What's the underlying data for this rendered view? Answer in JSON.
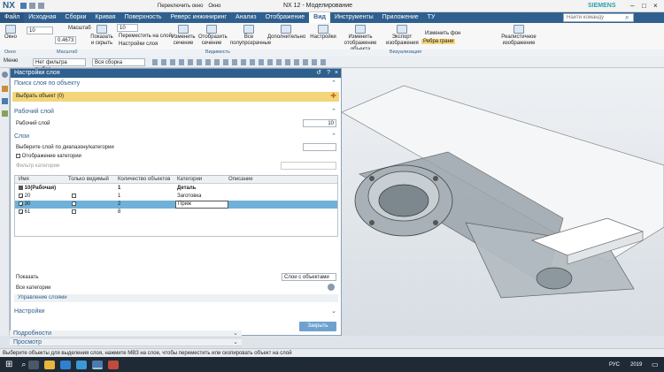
{
  "window": {
    "title": "NX 12 - Моделирование",
    "brand": "SIEMENS",
    "app_short": "NX",
    "switch_window": "Переключить окно",
    "window_menu": "Окно"
  },
  "search": {
    "placeholder": "Найти команду"
  },
  "menu": {
    "items": [
      "Файл",
      "Исходная",
      "Сборки",
      "Кривая",
      "Поверхность",
      "Реверс инжиниринг",
      "Анализ",
      "Отображение",
      "Вид",
      "Инструменты",
      "Приложение",
      "ТУ"
    ],
    "active_index": 8
  },
  "ribbon": {
    "buttons": [
      {
        "label": "Окно"
      },
      {
        "label": "Масштаб"
      },
      {
        "label": "Показать и скрыть"
      },
      {
        "label": "Переместить на слой"
      },
      {
        "label": "Настройки слоя"
      },
      {
        "label": "Изменить сечение"
      },
      {
        "label": "Отобразить сечение"
      },
      {
        "label": "Все полупрозрачные"
      },
      {
        "label": "Дополнительно"
      },
      {
        "label": "Настройки"
      },
      {
        "label": "Изменить отображение объекта"
      },
      {
        "label": "Экспорт изображения"
      },
      {
        "label": "Изменить фон"
      },
      {
        "label": "Ребра грани"
      },
      {
        "label": "Реалистичное изображение"
      }
    ],
    "layer_value": "10",
    "scale_value": "0.4673",
    "groups": [
      "Окно",
      "Масштаб",
      "Видимость",
      "Визуализация"
    ]
  },
  "toolbar2": {
    "menu": "Меню",
    "filter": "Нет фильтра выбор",
    "assembly": "Вся сборка"
  },
  "dialog": {
    "title": "Настройки слоя",
    "find_section": "Поиск слоя по объекту",
    "select_object": "Выбрать объект (0)",
    "work_section": "Рабочий слой",
    "work_layer_label": "Рабочий слой",
    "work_layer_value": "10",
    "layers_section": "Слои",
    "select_by_range": "Выберите слой по диапазону/категории",
    "show_category": "Отображение категории",
    "category_filter": "Фильтр категории",
    "columns": [
      "Имя",
      "Только видимый",
      "Количество объектов",
      "Категории",
      "Описание"
    ],
    "rows": [
      {
        "name": "10(Рабочая)",
        "visible_only": false,
        "count": "1",
        "category": "Деталь",
        "desc": "",
        "bold": true,
        "checkbox": false
      },
      {
        "name": "20",
        "visible_only": false,
        "count": "1",
        "category": "Заготовка",
        "desc": "",
        "bold": false,
        "checkbox": true
      },
      {
        "name": "30",
        "visible_only": false,
        "count": "2",
        "category": "Приж",
        "desc": "",
        "bold": false,
        "checkbox": true,
        "selected": true
      },
      {
        "name": "61",
        "visible_only": false,
        "count": "8",
        "category": "",
        "desc": "",
        "bold": false,
        "checkbox": true
      }
    ],
    "show_label": "Показать",
    "show_value": "Слои с объектами",
    "all_categories": "Все категории",
    "layer_management": "Управление слоями",
    "settings_section": "Настройки",
    "close_button": "Закрыть"
  },
  "bottom_panels": [
    "Подробности",
    "Просмотр"
  ],
  "status_text": "Выберите объекты для выделения слоя, нажмите МВЗ на слое, чтобы переместить или скопировать объект на слой",
  "taskbar": {
    "lang": "РУС",
    "time": "2019"
  },
  "colors": {
    "accent": "#2f5f8e",
    "selection": "#6fb1d9",
    "highlight": "#f3d57a"
  }
}
